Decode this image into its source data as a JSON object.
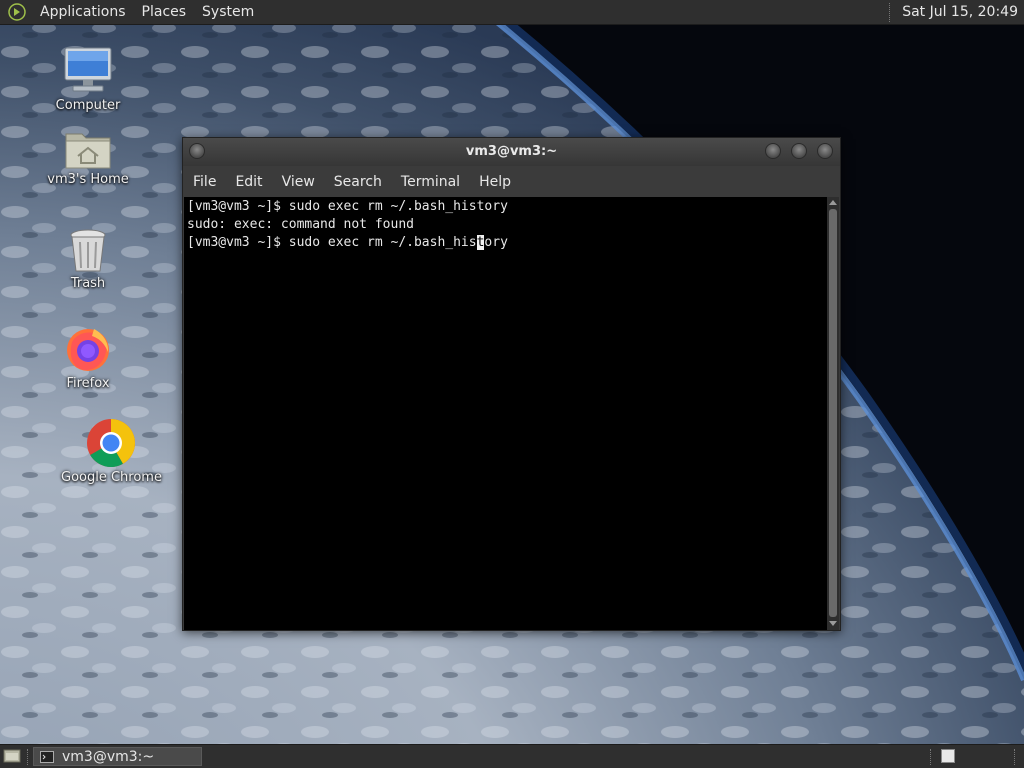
{
  "top_panel": {
    "menus": [
      "Applications",
      "Places",
      "System"
    ],
    "clock": "Sat Jul 15, 20:49"
  },
  "desktop_icons": [
    {
      "label": "Computer",
      "icon": "computer-icon"
    },
    {
      "label": "vm3's Home",
      "icon": "home-folder-icon"
    },
    {
      "label": "Trash",
      "icon": "trash-icon"
    },
    {
      "label": "Firefox",
      "icon": "firefox-icon"
    },
    {
      "label": "Google Chrome",
      "icon": "chrome-icon"
    }
  ],
  "terminal": {
    "title": "vm3@vm3:~",
    "menus": [
      "File",
      "Edit",
      "View",
      "Search",
      "Terminal",
      "Help"
    ],
    "lines": [
      "[vm3@vm3 ~]$ sudo exec rm ~/.bash_history",
      "sudo: exec: command not found"
    ],
    "prompt_before_cursor": "[vm3@vm3 ~]$ sudo exec rm ~/.bash_his",
    "cursor_char": "t",
    "prompt_after_cursor": "ory"
  },
  "taskbar": {
    "window_label": "vm3@vm3:~"
  },
  "colors": {
    "panel": "#2f2f2f",
    "terminal_bg": "#000000",
    "terminal_fg": "#e8e8e8"
  }
}
